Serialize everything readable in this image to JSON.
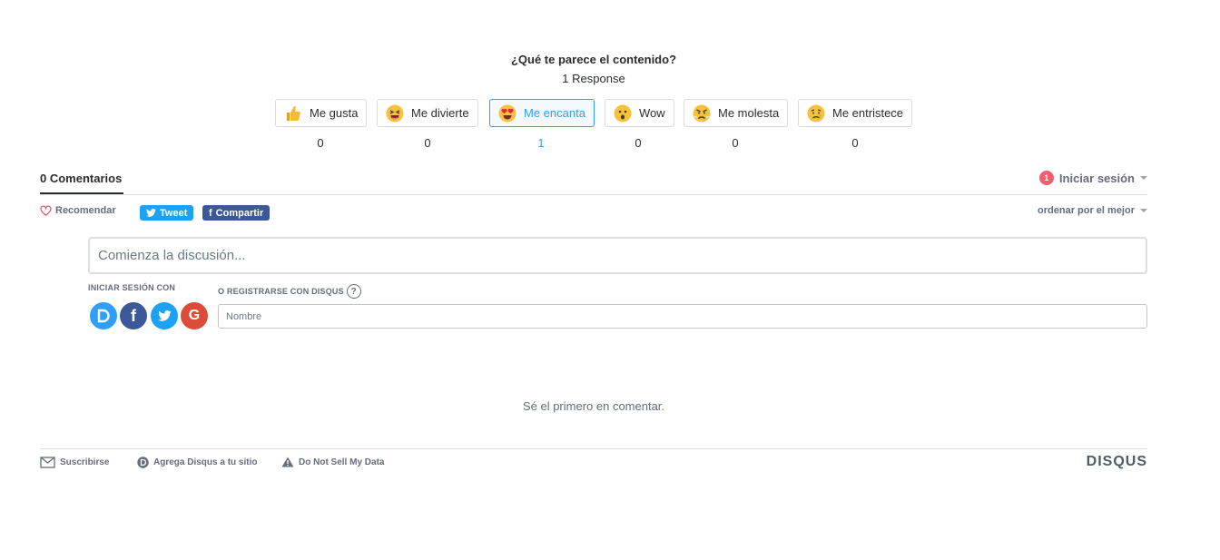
{
  "reactions": {
    "title": "¿Qué te parece el contenido?",
    "response_count": "1 Response",
    "items": [
      {
        "label": "Me gusta",
        "count": "0",
        "icon": "thumbs-up-icon"
      },
      {
        "label": "Me divierte",
        "count": "0",
        "icon": "laughing-face-icon"
      },
      {
        "label": "Me encanta",
        "count": "1",
        "icon": "heart-eyes-face-icon",
        "selected": true
      },
      {
        "label": "Wow",
        "count": "0",
        "icon": "surprised-face-icon"
      },
      {
        "label": "Me molesta",
        "count": "0",
        "icon": "angry-face-icon"
      },
      {
        "label": "Me entristece",
        "count": "0",
        "icon": "sad-face-icon"
      }
    ]
  },
  "thread": {
    "comments_tab": "0 Comentarios",
    "login_label": "Iniciar sesión",
    "notification_count": "1",
    "recommend_label": "Recomendar",
    "tweet_label": "Tweet",
    "share_label": "Compartir",
    "sort_label": "ordenar por el mejor"
  },
  "composer": {
    "placeholder": "Comienza la discusión...",
    "login_with_label": "INICIAR SESIÓN CON",
    "register_label": "O REGISTRARSE CON DISQUS",
    "name_placeholder": "Nombre",
    "social_providers": [
      "disqus",
      "facebook",
      "twitter",
      "google"
    ]
  },
  "empty_message": "Sé el primero en comentar.",
  "footer": {
    "subscribe_label": "Suscribirse",
    "add_disqus_label": "Agrega Disqus a tu sitio",
    "do_not_sell_label": "Do Not Sell My Data",
    "logo_text": "DISQUS"
  },
  "colors": {
    "accent": "#2e9fff",
    "twitter": "#1da1f2",
    "facebook": "#3b5998",
    "google": "#dd4b39",
    "disqus": "#2e9fff",
    "badge": "#f05f70"
  }
}
